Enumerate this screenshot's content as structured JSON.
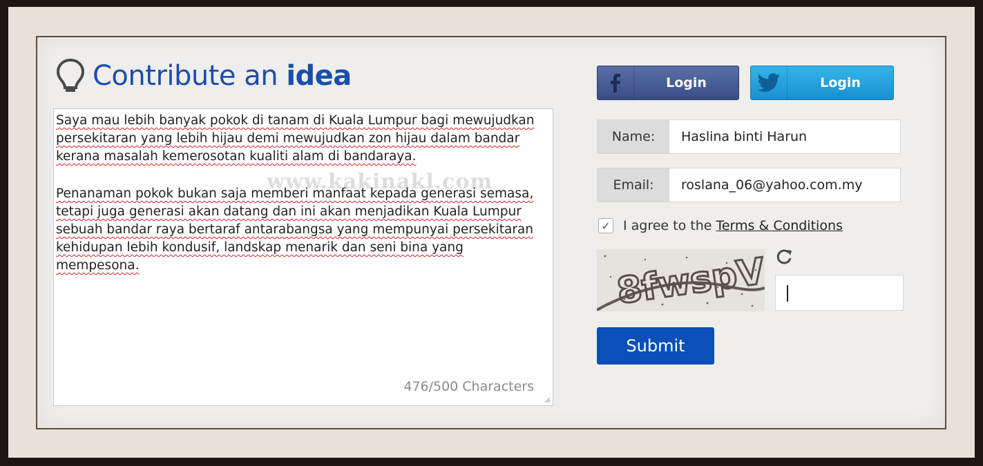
{
  "header": {
    "title_prefix": "Contribute an",
    "title_emphasis": "idea"
  },
  "idea_text": {
    "paragraph1": "Saya mau lebih banyak pokok di tanam di Kuala Lumpur bagi mewujudkan persekitaran yang lebih hijau demi mewujudkan zon hijau dalam bandar kerana masalah kemerosotan kualiti alam di bandaraya.",
    "paragraph2": "Penanaman pokok bukan saja memberi manfaat kepada generasi semasa, tetapi juga generasi akan datang  dan ini akan menjadikan Kuala Lumpur sebuah bandar raya bertaraf antarabangsa yang mempunyai persekitaran kehidupan lebih kondusif, landskap menarik dan seni bina yang mempesona.",
    "counter": "476/500 Characters",
    "watermark": "www.kakinakl.com"
  },
  "social": {
    "facebook_label": "Login",
    "twitter_label": "Login"
  },
  "form": {
    "name_label": "Name:",
    "name_value": "Haslina binti Harun",
    "email_label": "Email:",
    "email_value": "roslana_06@yahoo.com.my",
    "agree_text": "I agree to the",
    "terms_link": "Terms & Conditions",
    "agree_checked": true,
    "captcha_text": "8fwspV",
    "submit_label": "Submit"
  },
  "colors": {
    "title_blue": "#1a4eac",
    "facebook": "#3a4d86",
    "twitter": "#1a8fce",
    "submit": "#0b4fb9",
    "spell_underline": "#d42020"
  }
}
